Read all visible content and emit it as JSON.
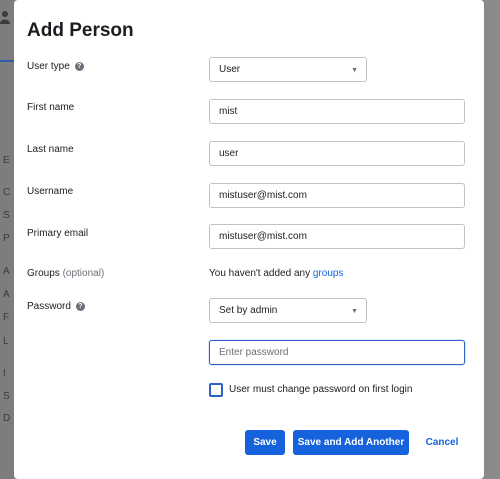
{
  "dialog": {
    "title": "Add Person"
  },
  "form": {
    "user_type": {
      "label": "User type",
      "value": "User"
    },
    "first_name": {
      "label": "First name",
      "value": "mist"
    },
    "last_name": {
      "label": "Last name",
      "value": "user"
    },
    "username": {
      "label": "Username",
      "value": "mistuser@mist.com"
    },
    "primary_email": {
      "label": "Primary email",
      "value": "mistuser@mist.com"
    },
    "groups": {
      "label": "Groups",
      "optional": "(optional)",
      "text": "You haven't added any",
      "link": "groups"
    },
    "password": {
      "label": "Password",
      "value": "Set by admin",
      "placeholder": "Enter password"
    },
    "change_password": {
      "label": "User must change password on first login",
      "checked": false
    }
  },
  "buttons": {
    "save": "Save",
    "save_and_add": "Save and Add Another",
    "cancel": "Cancel"
  },
  "background_letters": [
    "E",
    "C",
    "S",
    "P",
    "A",
    "A",
    "F",
    "L",
    "I",
    "S",
    "D"
  ],
  "icons": {
    "help": "?",
    "chevron": "▼"
  },
  "colors": {
    "accent": "#1662dd",
    "overlay": "#8a8a8a",
    "focus": "#2e62c6"
  }
}
